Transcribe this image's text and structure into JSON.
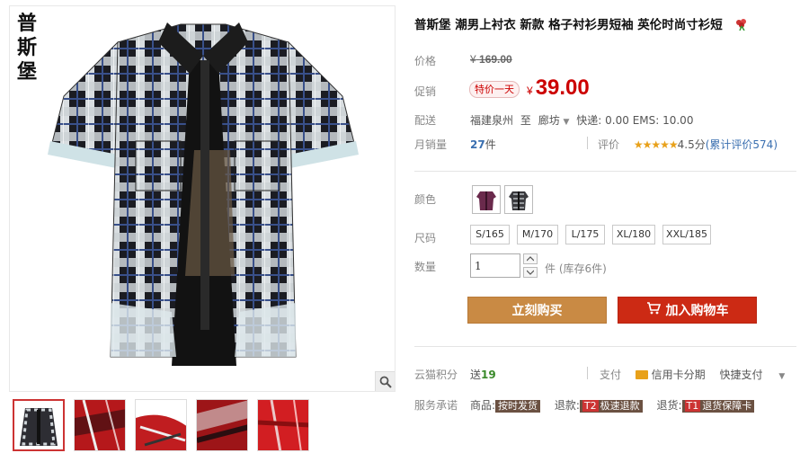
{
  "brand": {
    "vertical_text": "普\n斯\n堡"
  },
  "product": {
    "title": "普斯堡 潮男上衬衣 新款 格子衬衫男短袖 英伦时尚寸衫短",
    "orig_price_label": "价格",
    "orig_price_currency": "¥",
    "orig_price": "169.00",
    "promo_label": "促销",
    "promo_tag": "特价一天",
    "price_currency": "¥",
    "price": "39.00"
  },
  "shipping": {
    "label": "配送",
    "from": "福建泉州",
    "to_word": "至",
    "to": "廊坊",
    "express": "快递: 0.00",
    "ems": "EMS: 10.00"
  },
  "sales": {
    "label": "月销量",
    "count": "27",
    "unit": "件",
    "rating_label": "评价",
    "stars": "★★★★★",
    "score": "4.5分",
    "review_text": "(累计评价574)"
  },
  "options": {
    "color_label": "颜色",
    "size_label": "尺码",
    "sizes": [
      "S/165",
      "M/170",
      "L/175",
      "XL/180",
      "XXL/185"
    ],
    "qty_label": "数量",
    "qty_value": "1",
    "stock_text": "件 (库存6件)"
  },
  "actions": {
    "buy_now": "立刻购买",
    "add_cart": "加入购物车"
  },
  "points": {
    "label": "云猫积分",
    "send": "送",
    "value": "19",
    "pay_label": "支付",
    "credit_card": "信用卡分期",
    "quick_pay": "快捷支付"
  },
  "service": {
    "label": "服务承诺",
    "item1_label": "商品:",
    "item1_badge": "按时发货",
    "item2_label": "退款:",
    "item2_tag": "T2",
    "item2_badge": "极速退款",
    "item3_label": "退货:",
    "item3_tag": "T1",
    "item3_badge": "退货保障卡"
  },
  "colors": {
    "price_red": "#cc0000",
    "buy_btn": "#c98a44",
    "cart_btn": "#cc2a14",
    "star": "#e8a11a"
  }
}
